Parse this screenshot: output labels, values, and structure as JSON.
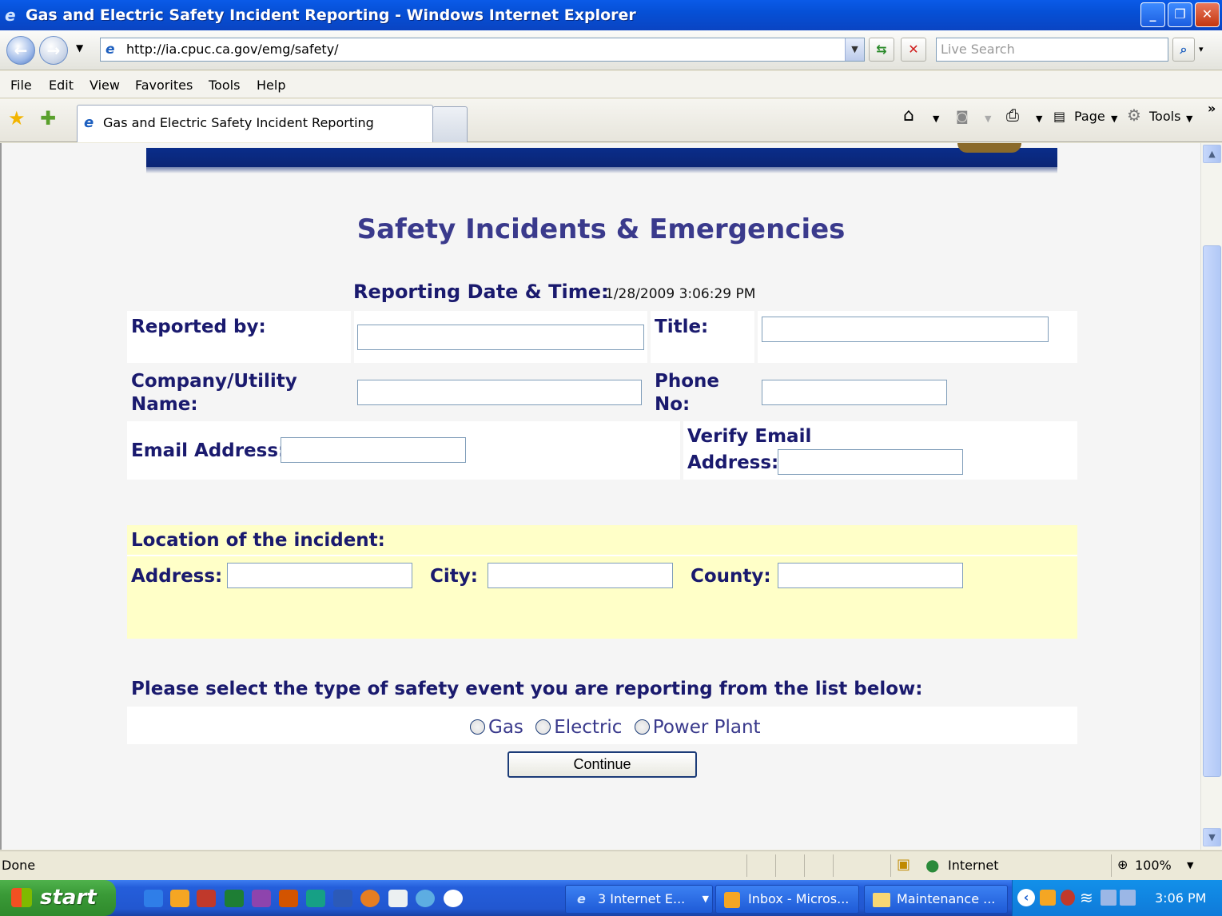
{
  "window": {
    "title": "Gas and Electric Safety Incident Reporting - Windows Internet Explorer",
    "controls": [
      "minimize",
      "restore",
      "close"
    ]
  },
  "address_bar": {
    "url": "http://ia.cpuc.ca.gov/emg/safety/",
    "search_placeholder": "Live Search"
  },
  "menu": [
    "File",
    "Edit",
    "View",
    "Favorites",
    "Tools",
    "Help"
  ],
  "tab": {
    "title": "Gas and Electric Safety Incident Reporting"
  },
  "command_bar": {
    "page_label": "Page",
    "tools_label": "Tools"
  },
  "form": {
    "heading": "Safety Incidents & Emergencies",
    "reporting_label": "Reporting Date & Time:",
    "reporting_value": "1/28/2009 3:06:29 PM",
    "reported_by_label": "Reported by:",
    "title_label": "Title:",
    "company_label_1": "Company/Utility",
    "company_label_2": "Name:",
    "phone_label_1": "Phone",
    "phone_label_2": "No:",
    "email_label": "Email Address:",
    "verify_label_1": "Verify Email",
    "verify_label_2": "Address:",
    "location_label": "Location of the incident:",
    "address_label": "Address:",
    "city_label": "City:",
    "county_label": "County:",
    "event_prompt": "Please select the type of safety event you are reporting  from the list below:",
    "event_types": [
      "Gas",
      "Electric",
      "Power Plant"
    ],
    "continue_label": "Continue"
  },
  "status_bar": {
    "status_text": "Done",
    "zone": "Internet",
    "zoom": "100%"
  },
  "taskbar": {
    "start_label": "start",
    "items": [
      "3 Internet E...",
      "Inbox - Micros...",
      "Maintenance ..."
    ],
    "clock": "3:06 PM"
  },
  "colors": {
    "label_navy": "#1a1a6e",
    "heading_purple": "#3a3a8c",
    "location_panel": "#ffffc8",
    "banner_blue": "#0b2575"
  }
}
